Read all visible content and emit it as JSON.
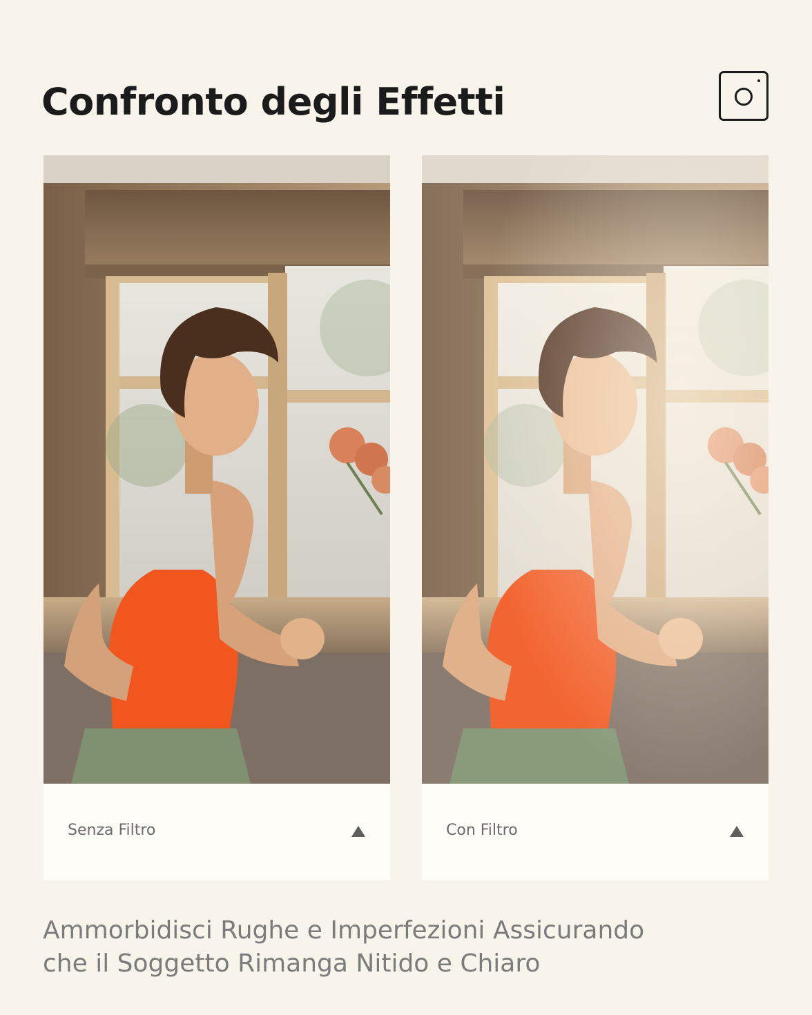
{
  "header": {
    "title": "Confronto degli Effetti",
    "icon": "instagram-camera-icon"
  },
  "comparison": [
    {
      "label": "Senza Filtro",
      "toggle_icon": "triangle-up-icon",
      "filtered": false
    },
    {
      "label": "Con Filtro",
      "toggle_icon": "triangle-up-icon",
      "filtered": true
    }
  ],
  "description": {
    "line1": "Ammorbidisci Rughe e Imperfezioni Assicurando",
    "line2": "che il Soggetto Rimanga Nitido e Chiaro"
  },
  "colors": {
    "background": "#f8f4ec",
    "title": "#1b1b1b",
    "caption_text": "#6b6b6b",
    "description_text": "#7b7b7b",
    "top_color": "#f0561d",
    "skirt_color": "#7f9170"
  }
}
